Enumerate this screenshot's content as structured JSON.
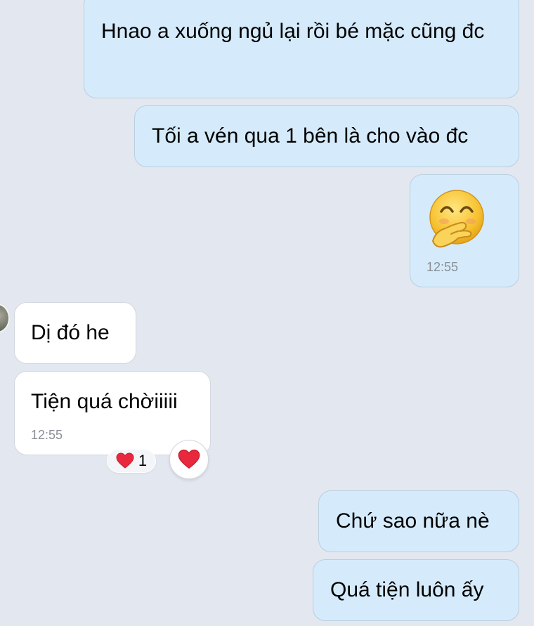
{
  "conversation": {
    "messages": [
      {
        "direction": "outgoing",
        "text": "Hnao a xuống ngủ lại rồi bé mặc cũng đc"
      },
      {
        "direction": "outgoing",
        "text": "Tối a vén qua 1 bên là cho vào đc"
      },
      {
        "direction": "outgoing",
        "sticker": "embarrassed-giggle-face",
        "time": "12:55"
      },
      {
        "direction": "incoming",
        "text": "Dị đó he"
      },
      {
        "direction": "incoming",
        "text": "Tiện quá chờiiiii",
        "time": "12:55",
        "reaction": {
          "icon": "heart-icon",
          "count": "1"
        }
      },
      {
        "direction": "outgoing",
        "text": "Chứ sao nữa nè"
      },
      {
        "direction": "outgoing",
        "text": "Quá tiện luôn ấy"
      }
    ]
  },
  "colors": {
    "background": "#e3e7ef",
    "outgoing_bubble": "#d5ebfb",
    "incoming_bubble": "#ffffff",
    "heart": "#e8283c"
  }
}
